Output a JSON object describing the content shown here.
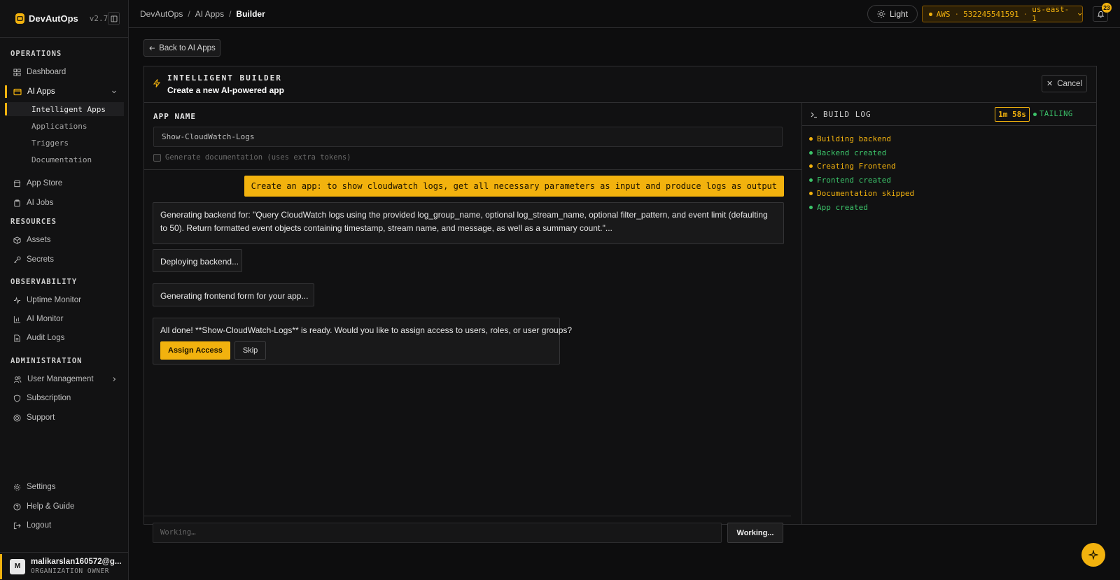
{
  "brand": {
    "name": "DevAutOps",
    "version": "v2.7"
  },
  "sidebar": {
    "sections": [
      "OPERATIONS",
      "RESOURCES",
      "OBSERVABILITY",
      "ADMINISTRATION"
    ],
    "items": [
      {
        "label": "Dashboard"
      },
      {
        "label": "AI Apps"
      },
      {
        "label": "App Store"
      },
      {
        "label": "AI Jobs"
      },
      {
        "label": "Assets"
      },
      {
        "label": "Secrets"
      },
      {
        "label": "Uptime Monitor"
      },
      {
        "label": "AI Monitor"
      },
      {
        "label": "Audit Logs"
      },
      {
        "label": "User Management"
      },
      {
        "label": "Subscription"
      },
      {
        "label": "Support"
      },
      {
        "label": "Settings"
      },
      {
        "label": "Help & Guide"
      },
      {
        "label": "Logout"
      }
    ],
    "subitems": [
      {
        "label": "Intelligent Apps"
      },
      {
        "label": "Applications"
      },
      {
        "label": "Triggers"
      },
      {
        "label": "Documentation"
      }
    ],
    "user": {
      "initial": "M",
      "name": "malikarslan160572@g...",
      "role": "ORGANIZATION OWNER"
    }
  },
  "topbar": {
    "breadcrumb": [
      "DevAutOps",
      "AI Apps",
      "Builder"
    ],
    "theme_label": "Light",
    "aws": {
      "provider": "AWS",
      "account": "532245541591",
      "region": "us-east-1"
    },
    "notifications": "23"
  },
  "main": {
    "back_label": "Back to AI Apps",
    "header": {
      "title": "INTELLIGENT BUILDER",
      "subtitle": "Create a new AI-powered app",
      "cancel": "Cancel"
    },
    "app_name_label": "APP NAME",
    "app_name_value": "Show-CloudWatch-Logs",
    "doc_checkbox_label": "Generate documentation (uses extra tokens)",
    "user_message": "Create an app: to show cloudwatch logs, get all necessary parameters as input and produce logs as output",
    "messages": [
      "Generating backend for: \"Query CloudWatch logs using the provided log_group_name, optional log_stream_name, optional filter_pattern, and event limit (defaulting to 50). Return formatted event objects containing timestamp, stream name, and message, as well as a summary count.\"...",
      "Deploying backend...",
      "Generating frontend form for your app...",
      "All done! **Show-CloudWatch-Logs** is ready. Would you like to assign access to users, roles, or user groups?"
    ],
    "assign_label": "Assign Access",
    "skip_label": "Skip",
    "input_placeholder": "Working…",
    "send_label": "Working..."
  },
  "build_log": {
    "title": "BUILD LOG",
    "timer": "1m 58s",
    "status": "TAILING",
    "lines": [
      {
        "text": "Building backend",
        "color": "#f2b20e"
      },
      {
        "text": "Backend created",
        "color": "#3cc46a"
      },
      {
        "text": "Creating Frontend",
        "color": "#f2b20e"
      },
      {
        "text": "Frontend created",
        "color": "#3cc46a"
      },
      {
        "text": "Documentation skipped",
        "color": "#f2b20e"
      },
      {
        "text": "App created",
        "color": "#3cc46a"
      }
    ]
  },
  "colors": {
    "accent": "#f2b20e",
    "success": "#3cc46a",
    "background": "#0d0d0e"
  }
}
